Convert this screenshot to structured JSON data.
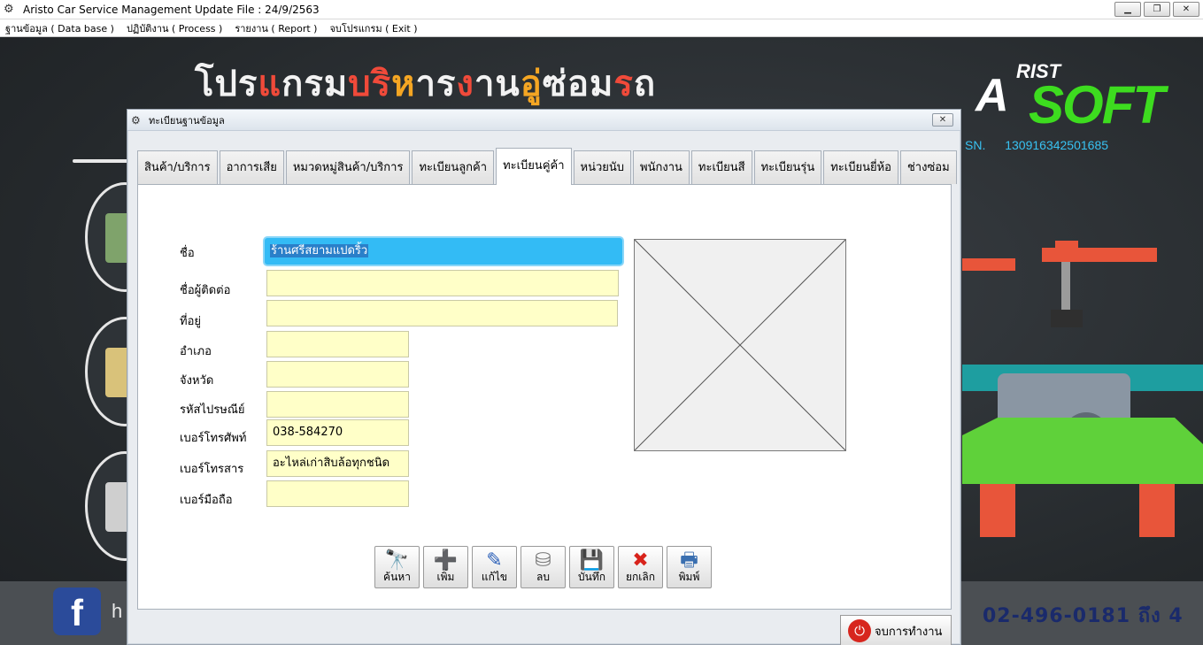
{
  "window": {
    "title": "Aristo Car Service Management   Update File : 24/9/2563",
    "icon": "app-gear-icon",
    "controls": {
      "minimize": "▁",
      "restore": "❐",
      "close": "✕"
    }
  },
  "menu": [
    "ฐานข้อมูล ( Data base )",
    "ปฏิบัติงาน ( Process )",
    "รายงาน ( Report )",
    "จบโปรแกรม ( Exit )"
  ],
  "background": {
    "banner_parts": [
      {
        "text": "โปร",
        "tone": "w"
      },
      {
        "text": "แ",
        "tone": "r"
      },
      {
        "text": "กรม",
        "tone": "w"
      },
      {
        "text": "บริ",
        "tone": "r"
      },
      {
        "text": "ห",
        "tone": "o"
      },
      {
        "text": "าร",
        "tone": "w"
      },
      {
        "text": "ง",
        "tone": "r"
      },
      {
        "text": "าน",
        "tone": "w"
      },
      {
        "text": "อู่",
        "tone": "o"
      },
      {
        "text": "ซ่อม",
        "tone": "w"
      },
      {
        "text": "ร",
        "tone": "r"
      },
      {
        "text": "ถ",
        "tone": "w"
      }
    ],
    "logo_a": "A",
    "logo_rist": "RIST",
    "logo_soft": "SOFT",
    "sn_label": "SN.",
    "sn_value": "130916342501685",
    "fb_letter": "f",
    "fb_text": "h",
    "phone": "02-496-0181 ถึง 4",
    "colors": {
      "banner_red": "#f04a3a",
      "banner_orange": "#f5a623",
      "logo_green": "#3ddc1f",
      "sn_cyan": "#38c2f2"
    }
  },
  "dialog": {
    "title": "ทะเบียนฐานข้อมูล",
    "close_label": "✕",
    "tabs": [
      "สินค้า/บริการ",
      "อาการเสีย",
      "หมวดหมู่สินค้า/บริการ",
      "ทะเบียนลูกค้า",
      "ทะเบียนคู่ค้า",
      "หน่วยนับ",
      "พนักงาน",
      "ทะเบียนสี",
      "ทะเบียนรุ่น",
      "ทะเบียนยี่ห้อ",
      "ช่างซ่อม"
    ],
    "active_tab": "ทะเบียนคู่ค้า",
    "form": {
      "name": {
        "label": "ชื่อ",
        "value": "ร้านศรีสยามแปดริ้ว"
      },
      "contact": {
        "label": "ชื่อผู้ติดต่อ",
        "value": ""
      },
      "address": {
        "label": "ที่อยู่",
        "value": ""
      },
      "district": {
        "label": "อำเภอ",
        "value": ""
      },
      "province": {
        "label": "จังหวัด",
        "value": ""
      },
      "postcode": {
        "label": "รหัสไปรษณีย์",
        "value": ""
      },
      "phone": {
        "label": "เบอร์โทรศัพท์",
        "value": "038-584270"
      },
      "fax": {
        "label": "เบอร์โทรสาร",
        "value": "อะไหล่เก่าสิบล้อทุกชนิด"
      },
      "mobile": {
        "label": "เบอร์มือถือ",
        "value": ""
      }
    },
    "buttons": [
      {
        "label": "ค้นหา",
        "icon": "binoculars-icon",
        "glyph": "🔭"
      },
      {
        "label": "เพิ่ม",
        "icon": "add-record-icon",
        "glyph": "➕"
      },
      {
        "label": "แก้ไข",
        "icon": "edit-icon",
        "glyph": "✎"
      },
      {
        "label": "ลบ",
        "icon": "delete-record-icon",
        "glyph": "⛁"
      },
      {
        "label": "บันทึก",
        "icon": "save-icon",
        "glyph": "💾"
      },
      {
        "label": "ยกเลิก",
        "icon": "cancel-icon",
        "glyph": "✖"
      },
      {
        "label": "พิมพ์",
        "icon": "printer-icon",
        "glyph": "🖶"
      }
    ],
    "exit_label": "จบการทำงาน",
    "exit_icon": "power-icon"
  }
}
